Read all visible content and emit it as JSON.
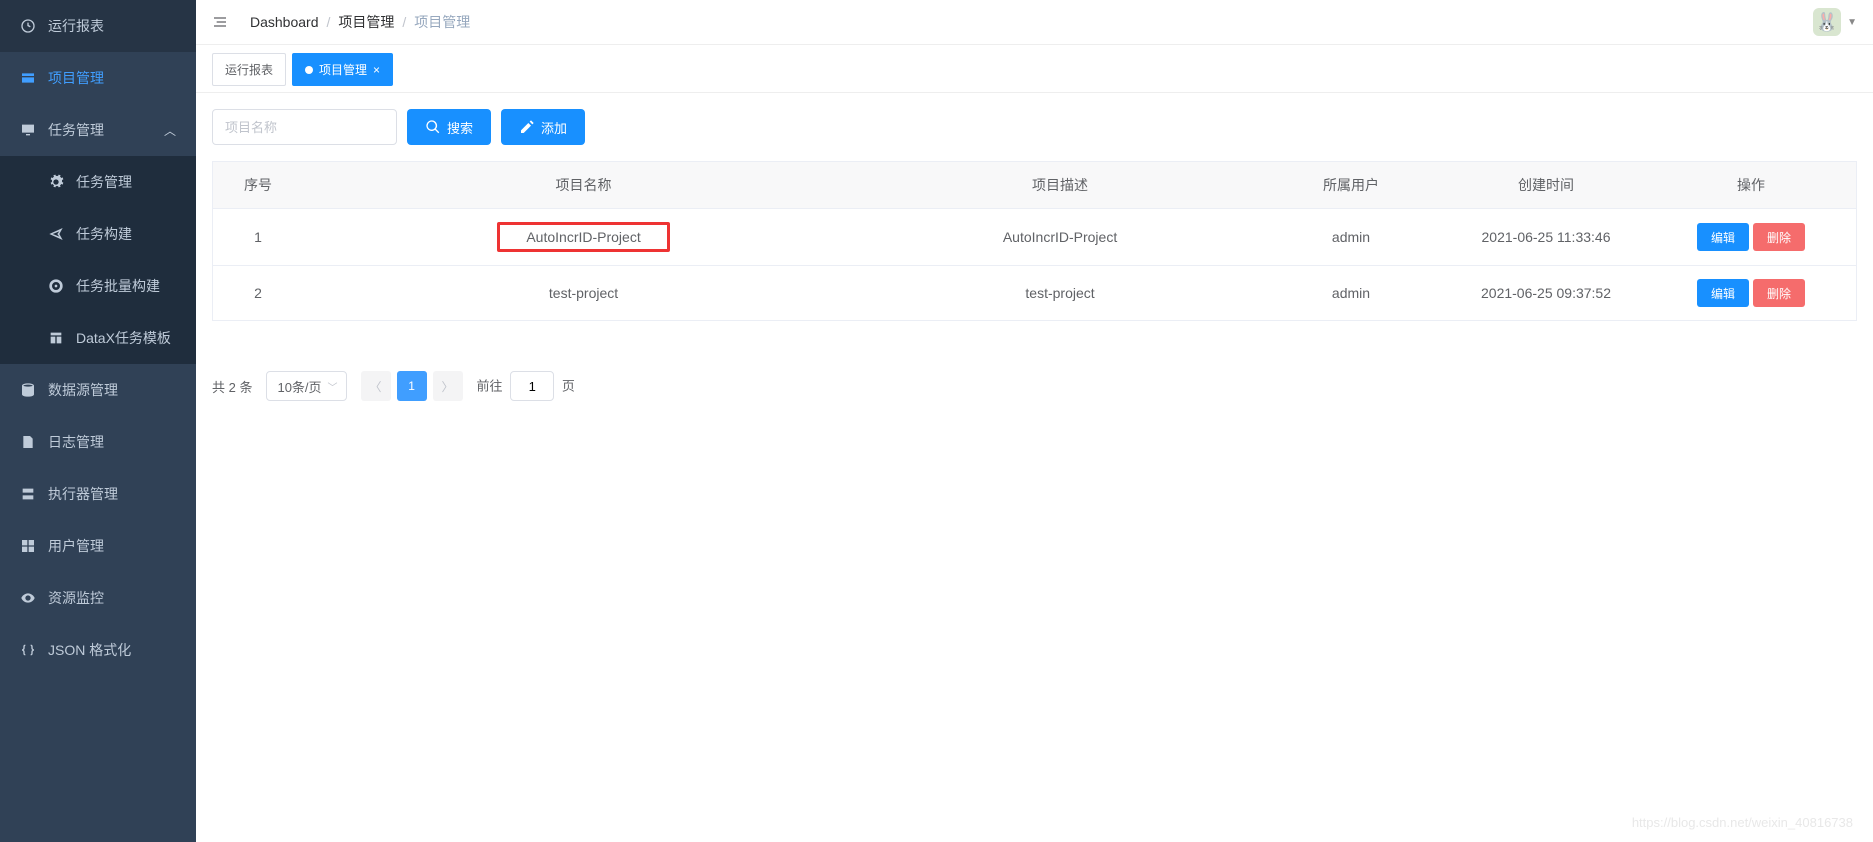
{
  "sidebar": {
    "items": [
      {
        "label": "运行报表",
        "icon": "dashboard"
      },
      {
        "label": "项目管理",
        "icon": "project",
        "active": true
      },
      {
        "label": "任务管理",
        "icon": "monitor",
        "expanded": true
      },
      {
        "label": "任务管理",
        "icon": "setting",
        "sub": true
      },
      {
        "label": "任务构建",
        "icon": "plane",
        "sub": true
      },
      {
        "label": "任务批量构建",
        "icon": "target",
        "sub": true
      },
      {
        "label": "DataX任务模板",
        "icon": "template",
        "sub": true
      },
      {
        "label": "数据源管理",
        "icon": "database"
      },
      {
        "label": "日志管理",
        "icon": "doc"
      },
      {
        "label": "执行器管理",
        "icon": "executor"
      },
      {
        "label": "用户管理",
        "icon": "grid"
      },
      {
        "label": "资源监控",
        "icon": "eye"
      },
      {
        "label": "JSON 格式化",
        "icon": "code"
      }
    ]
  },
  "breadcrumb": {
    "root": "Dashboard",
    "mid": "项目管理",
    "current": "项目管理"
  },
  "tabs": [
    {
      "label": "运行报表",
      "active": false
    },
    {
      "label": "项目管理",
      "active": true
    }
  ],
  "toolbar": {
    "search_placeholder": "项目名称",
    "search_btn": "搜索",
    "add_btn": "添加"
  },
  "table": {
    "headers": [
      "序号",
      "项目名称",
      "项目描述",
      "所属用户",
      "创建时间",
      "操作"
    ],
    "edit_label": "编辑",
    "delete_label": "删除",
    "rows": [
      {
        "seq": "1",
        "name": "AutoIncrID-Project",
        "desc": "AutoIncrID-Project",
        "user": "admin",
        "time": "2021-06-25 11:33:46",
        "highlight": true
      },
      {
        "seq": "2",
        "name": "test-project",
        "desc": "test-project",
        "user": "admin",
        "time": "2021-06-25 09:37:52",
        "highlight": false
      }
    ]
  },
  "pagination": {
    "total_text": "共 2 条",
    "page_size": "10条/页",
    "current_page": "1",
    "jump_prefix": "前往",
    "jump_value": "1",
    "jump_suffix": "页"
  },
  "watermark": "https://blog.csdn.net/weixin_40816738"
}
